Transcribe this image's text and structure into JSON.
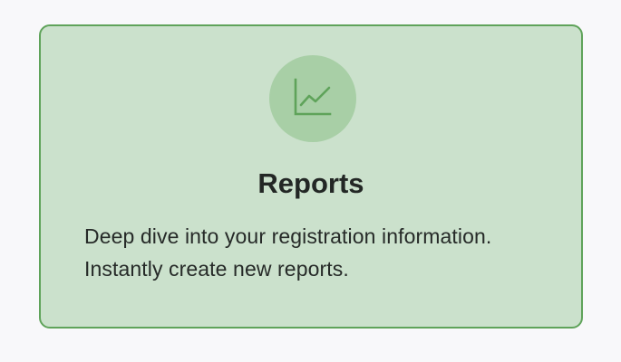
{
  "card": {
    "icon": "chart-line-icon",
    "title": "Reports",
    "description_lines": [
      "Deep dive into your registration information.",
      "Instantly create new reports."
    ]
  },
  "colors": {
    "page_background": "#f8f8fa",
    "card_background": "#cbe1cc",
    "card_border": "#5fa35a",
    "icon_circle": "#a8cfa6",
    "icon_stroke": "#5fa35a",
    "text": "#232725"
  }
}
